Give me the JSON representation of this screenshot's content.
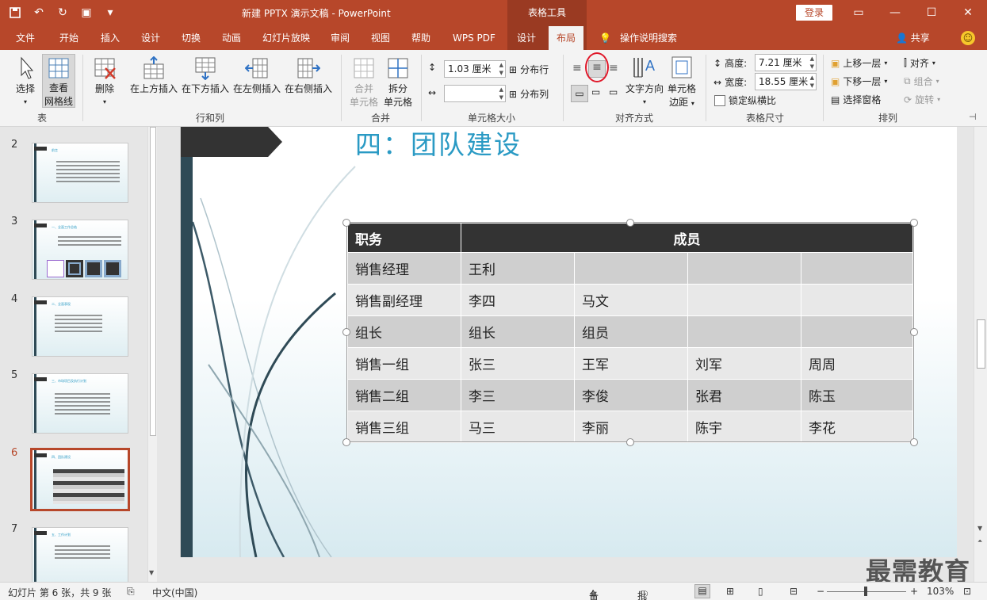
{
  "titlebar": {
    "doc_title": "新建 PPTX 演示文稿 - PowerPoint",
    "context_header": "表格工具",
    "login": "登录",
    "qat_icons": [
      "save-icon",
      "undo-icon",
      "redo-icon",
      "present-icon",
      "customize-icon"
    ]
  },
  "tabs": [
    {
      "label": "文件"
    },
    {
      "label": "开始"
    },
    {
      "label": "插入"
    },
    {
      "label": "设计"
    },
    {
      "label": "切换"
    },
    {
      "label": "动画"
    },
    {
      "label": "幻灯片放映"
    },
    {
      "label": "审阅"
    },
    {
      "label": "视图"
    },
    {
      "label": "帮助"
    },
    {
      "label": "WPS PDF"
    },
    {
      "label": "设计"
    },
    {
      "label": "布局"
    }
  ],
  "tell_me": "操作说明搜索",
  "share": "共享",
  "ribbon": {
    "table_group": {
      "label": "表",
      "select": "选择",
      "view_grid_1": "查看",
      "view_grid_2": "网格线"
    },
    "rows_cols_group": {
      "label": "行和列",
      "delete": "删除",
      "insert_above": "在上方插入",
      "insert_below": "在下方插入",
      "insert_left": "在左侧插入",
      "insert_right": "在右侧插入"
    },
    "merge_group": {
      "label": "合并",
      "merge_1": "合并",
      "merge_2": "单元格",
      "split_1": "拆分",
      "split_2": "单元格"
    },
    "cell_size_group": {
      "label": "单元格大小",
      "height_value": "1.03 厘米",
      "width_value": "",
      "distribute_rows": "分布行",
      "distribute_cols": "分布列"
    },
    "align_group": {
      "label": "对齐方式",
      "text_direction": "文字方向",
      "cell_margins_1": "单元格",
      "cell_margins_2": "边距"
    },
    "table_size_group": {
      "label": "表格尺寸",
      "height_label": "高度:",
      "height_value": "7.21 厘米",
      "width_label": "宽度:",
      "width_value": "18.55 厘米",
      "lock_ratio": "锁定纵横比"
    },
    "arrange_group": {
      "label": "排列",
      "bring_forward": "上移一层",
      "send_backward": "下移一层",
      "selection_pane": "选择窗格",
      "align": "对齐",
      "group": "组合",
      "rotate": "旋转"
    }
  },
  "thumbnails": [
    {
      "num": "2",
      "title": "前言"
    },
    {
      "num": "3",
      "title": "一、全面工作总结"
    },
    {
      "num": "4",
      "title": "二、全面表现"
    },
    {
      "num": "5",
      "title": "三、市场项目及执行计划"
    },
    {
      "num": "6",
      "title": "四、团队建设"
    },
    {
      "num": "7",
      "title": "五、工作计划"
    }
  ],
  "slide": {
    "title": "四：团队建设",
    "table": {
      "headers": [
        "职务",
        "成员"
      ],
      "rows": [
        [
          "销售经理",
          "王利",
          "",
          "",
          ""
        ],
        [
          "销售副经理",
          "李四",
          "马文",
          "",
          ""
        ],
        [
          "组长",
          "组长",
          "组员",
          "",
          ""
        ],
        [
          "销售一组",
          "张三",
          "王军",
          "刘军",
          "周周"
        ],
        [
          "销售二组",
          "李三",
          "李俊",
          "张君",
          "陈玉"
        ],
        [
          "销售三组",
          "马三",
          "李丽",
          "陈宇",
          "李花"
        ]
      ]
    }
  },
  "watermark": "最需教育",
  "status": {
    "slide_info": "幻灯片 第 6 张，共 9 张",
    "language": "中文(中国)",
    "notes": "备注",
    "comments": "批注",
    "zoom": "103%"
  },
  "colors": {
    "accent": "#b7472a",
    "title_blue": "#2a9ac4",
    "dark": "#333333"
  }
}
